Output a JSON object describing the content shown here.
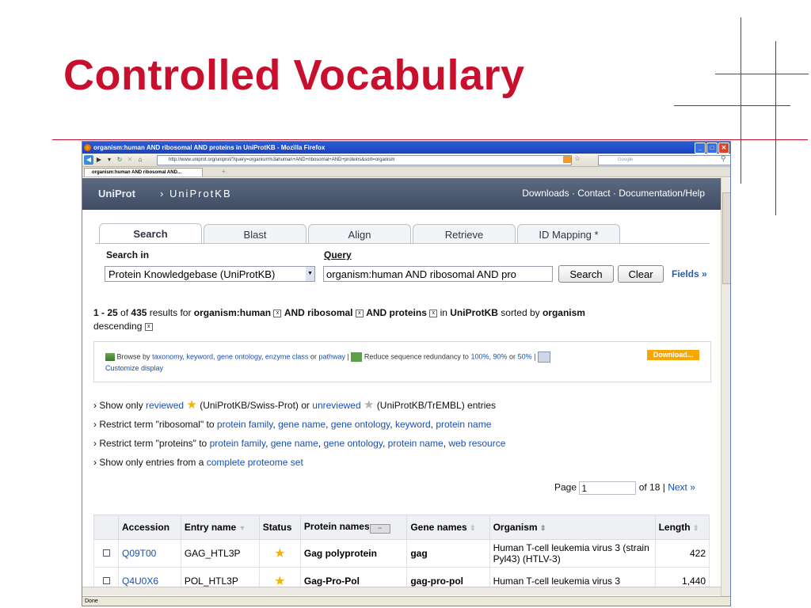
{
  "slide": {
    "title": "Controlled Vocabulary"
  },
  "browser": {
    "window_title": "organism:human AND ribosomal AND proteins in UniProtKB - Mozilla Firefox",
    "url": "http://www.uniprot.org/uniprot/?query=organism%3ahuman+AND+ribosomal+AND+proteins&sort=organism",
    "search_placeholder": "Google",
    "tab_label": "organism:human AND ribosomal AND...",
    "status": "Done"
  },
  "header": {
    "logo": "UniProt",
    "crumb": "› UniProtKB",
    "links": "Downloads · Contact · Documentation/Help"
  },
  "search_tabs": [
    "Search",
    "Blast",
    "Align",
    "Retrieve",
    "ID Mapping *"
  ],
  "form": {
    "search_in_label": "Search in",
    "search_in_value": "Protein Knowledgebase (UniProtKB)",
    "query_label": "Query",
    "query_value": "organism:human AND ribosomal AND pro",
    "search_button": "Search",
    "clear_button": "Clear",
    "fields_link": "Fields »"
  },
  "results": {
    "range": "1 - 25",
    "of": "of",
    "total": "435",
    "results_for": "results for",
    "term1": "organism:human",
    "and1": "AND ribosomal",
    "and2": "AND proteins",
    "in": "in",
    "db": "UniProtKB",
    "sorted_by": "sorted by",
    "sort_field": "organism",
    "sort_dir": "descending"
  },
  "browse": {
    "prefix": "Browse by",
    "taxonomy": "taxonomy",
    "keyword": "keyword",
    "go": "gene ontology",
    "enzyme": "enzyme class",
    "or": "or",
    "pathway": "pathway",
    "reduce": "Reduce sequence redundancy to",
    "p100": "100%",
    "p90": "90%",
    "or2": "or",
    "p50": "50%",
    "customize": "Customize display",
    "download": "Download..."
  },
  "options": {
    "o1_pre": "› Show only",
    "o1_reviewed": "reviewed",
    "o1_mid": "(UniProtKB/Swiss-Prot) or",
    "o1_unreviewed": "unreviewed",
    "o1_post": "(UniProtKB/TrEMBL) entries",
    "o2_pre": "› Restrict term \"ribosomal\" to",
    "o2_links": [
      "protein family",
      "gene name",
      "gene ontology",
      "keyword",
      "protein name"
    ],
    "o3_pre": "› Restrict term \"proteins\" to",
    "o3_links": [
      "protein family",
      "gene name",
      "gene ontology",
      "protein name",
      "web resource"
    ],
    "o4_pre": "› Show only entries from a",
    "o4_link": "complete proteome set"
  },
  "pager": {
    "page_label": "Page",
    "page_value": "1",
    "of_label": "of 18 |",
    "next": "Next »"
  },
  "table": {
    "headers": [
      "Accession",
      "Entry name",
      "Status",
      "Protein names",
      "Gene names",
      "Organism",
      "Length"
    ],
    "rows": [
      {
        "accession": "Q09T00",
        "entry": "GAG_HTL3P",
        "protein": "Gag polyprotein",
        "gene": "gag",
        "organism": "Human T-cell leukemia virus 3 (strain Pyl43) (HTLV-3)",
        "length": "422"
      },
      {
        "accession": "Q4U0X6",
        "entry": "POL_HTL3P",
        "protein": "Gag-Pro-Pol",
        "gene": "gag-pro-pol",
        "organism": "Human T-cell leukemia virus 3",
        "length": "1,440"
      }
    ]
  }
}
